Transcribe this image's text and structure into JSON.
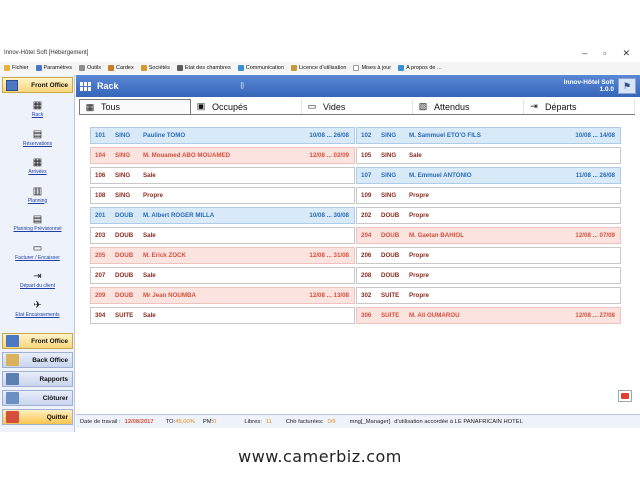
{
  "window": {
    "title": "Innov-Hôtel Soft [Hébergement]"
  },
  "menu": [
    {
      "label": "Fichier",
      "icon": "folder-icon",
      "color": "#e8b33a"
    },
    {
      "label": "Paramètres",
      "icon": "tools-icon",
      "color": "#4a78c4"
    },
    {
      "label": "Outils",
      "icon": "wrench-icon",
      "color": "#8c8c8c"
    },
    {
      "label": "Cardex",
      "icon": "cardex-icon",
      "color": "#c77d2a"
    },
    {
      "label": "Sociétés",
      "icon": "company-icon",
      "color": "#d19a2e"
    },
    {
      "label": "Etat des chambres",
      "icon": "bed-icon",
      "color": "#5b5b5b"
    },
    {
      "label": "Communication",
      "icon": "communication-icon",
      "color": "#3a8fd4"
    },
    {
      "label": "Licence d'utilisation",
      "icon": "license-icon",
      "color": "#c69a3a"
    },
    {
      "label": "Mises à jour",
      "icon": "update-icon",
      "color": "#ffffff"
    },
    {
      "label": "A propos de ...",
      "icon": "info-icon",
      "color": "#3a8fd4"
    }
  ],
  "sidebar": {
    "header": "Front Office",
    "items": [
      {
        "label": "Rack",
        "icon": "rack-icon",
        "glyph": "▦"
      },
      {
        "label": "Réservations",
        "icon": "reservations-icon",
        "glyph": "▤"
      },
      {
        "label": "Arrivées",
        "icon": "arrivals-icon",
        "glyph": "▦"
      },
      {
        "label": "Planning",
        "icon": "planning-icon",
        "glyph": "▥"
      },
      {
        "label": "Planning Prévisionnel",
        "icon": "forecast-icon",
        "glyph": "▤"
      },
      {
        "label": "Facturer / Encaisser",
        "icon": "invoice-icon",
        "glyph": "▭"
      },
      {
        "label": "Départ du client",
        "icon": "departure-icon",
        "glyph": "⇥"
      },
      {
        "label": "Etat Encaissements",
        "icon": "payments-icon",
        "glyph": "✈"
      }
    ],
    "sections": [
      {
        "label": "Front Office",
        "icon": "front-office-icon",
        "color": "#4a78c4"
      },
      {
        "label": "Back Office",
        "icon": "back-office-icon",
        "color": "#d9b25a"
      },
      {
        "label": "Rapports",
        "icon": "reports-icon",
        "color": "#5c7fb3"
      },
      {
        "label": "Clôturer",
        "icon": "close-day-icon",
        "color": "#6b8fc2"
      },
      {
        "label": "Quitter",
        "icon": "quit-icon",
        "color": "#d5503c"
      }
    ]
  },
  "rack": {
    "title": "Rack",
    "marker": "[]",
    "brand_line1": "Innov-Hôtel Soft",
    "brand_line2": "1.0.0",
    "tabs": [
      {
        "label": "Tous",
        "icon": "all-icon",
        "glyph": "▦"
      },
      {
        "label": "Occupés",
        "icon": "occupied-icon",
        "glyph": "▣"
      },
      {
        "label": "Vides",
        "icon": "empty-bed-icon",
        "glyph": "▭"
      },
      {
        "label": "Attendus",
        "icon": "expected-icon",
        "glyph": "▧"
      },
      {
        "label": "Départs",
        "icon": "departures-icon",
        "glyph": "⇥"
      }
    ],
    "left": [
      {
        "num": "101",
        "type": "SING",
        "guest": "Pauline TOMO",
        "dates": "10/08 ... 26/08",
        "status": "occ"
      },
      {
        "num": "104",
        "type": "SING",
        "guest": "M. Mouamed ABO MOUAMED",
        "dates": "12/08 ... 02/09",
        "status": "dep"
      },
      {
        "num": "106",
        "type": "SING",
        "guest": "Sale",
        "dates": "",
        "status": "free"
      },
      {
        "num": "108",
        "type": "SING",
        "guest": "Propre",
        "dates": "",
        "status": "free"
      },
      {
        "num": "201",
        "type": "DOUB",
        "guest": "M. Albert ROGER MILLA",
        "dates": "10/08 ... 30/08",
        "status": "occ"
      },
      {
        "num": "203",
        "type": "DOUB",
        "guest": "Sale",
        "dates": "",
        "status": "free"
      },
      {
        "num": "205",
        "type": "DOUB",
        "guest": "M. Erick ZOCK",
        "dates": "12/08 ... 31/08",
        "status": "dep"
      },
      {
        "num": "207",
        "type": "DOUB",
        "guest": "Sale",
        "dates": "",
        "status": "free"
      },
      {
        "num": "209",
        "type": "DOUB",
        "guest": "Mr Jean NOUMBA",
        "dates": "12/08 ... 13/08",
        "status": "dep"
      },
      {
        "num": "304",
        "type": "SUITE",
        "guest": "Sale",
        "dates": "",
        "status": "free"
      }
    ],
    "right": [
      {
        "num": "102",
        "type": "SING",
        "guest": "M. Sammuel ETO'O FILS",
        "dates": "10/08 ... 14/08",
        "status": "occ"
      },
      {
        "num": "105",
        "type": "SING",
        "guest": "Sale",
        "dates": "",
        "status": "free"
      },
      {
        "num": "107",
        "type": "SING",
        "guest": "M. Emmuel ANTONIO",
        "dates": "11/08 ... 26/08",
        "status": "occ"
      },
      {
        "num": "109",
        "type": "SING",
        "guest": "Propre",
        "dates": "",
        "status": "free"
      },
      {
        "num": "202",
        "type": "DOUB",
        "guest": "Propre",
        "dates": "",
        "status": "free"
      },
      {
        "num": "204",
        "type": "DOUB",
        "guest": "M. Gaetan BAHIOL",
        "dates": "12/08 ... 07/09",
        "status": "dep"
      },
      {
        "num": "206",
        "type": "DOUB",
        "guest": "Propre",
        "dates": "",
        "status": "free"
      },
      {
        "num": "208",
        "type": "DOUB",
        "guest": "Propre",
        "dates": "",
        "status": "free"
      },
      {
        "num": "302",
        "type": "SUITE",
        "guest": "Propre",
        "dates": "",
        "status": "free"
      },
      {
        "num": "306",
        "type": "SUITE",
        "guest": "M. Ali OUMAROU",
        "dates": "12/08 ... 27/08",
        "status": "dep"
      }
    ]
  },
  "status": {
    "date_label": "Date de travail :",
    "date_value": "12/08/2017",
    "to_label": "TO:",
    "to_value": "45,00%",
    "pm_label": "PM:",
    "pm_value": "0",
    "free_label": "Libres:",
    "free_value": "11",
    "billed_label": "Chb facturées:",
    "billed_value": "0/9",
    "user": "mng[_Manager]",
    "license": "d'utilisation accordée à LE PANAFRICAIN HOTEL"
  },
  "watermark": "www.camerbiz.com",
  "colors": {
    "occupied": "#2a6db9",
    "departure": "#d5503c",
    "free": "#8a2a1e",
    "header": "#3565b8"
  }
}
